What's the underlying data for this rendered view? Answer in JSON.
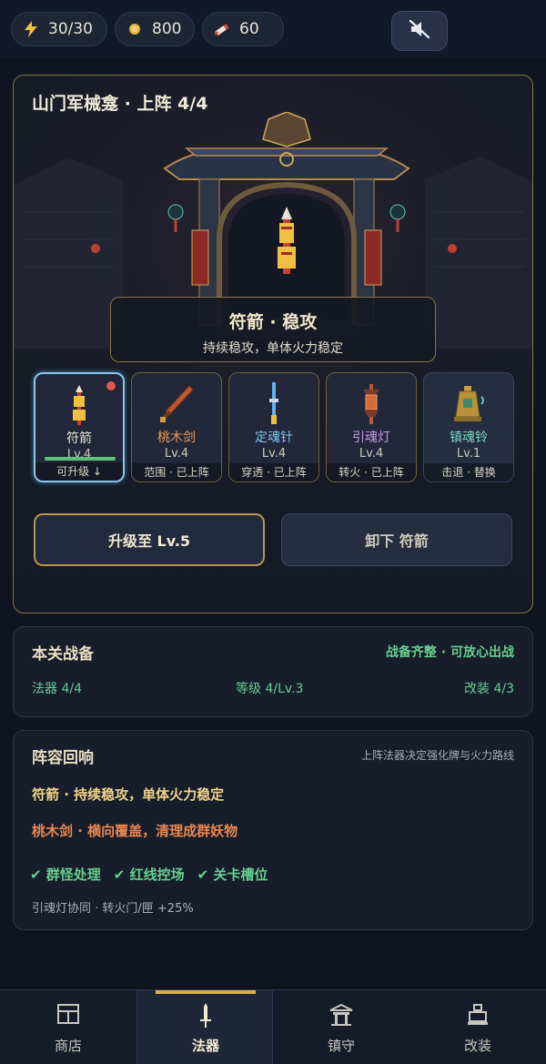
{
  "resources": {
    "energy": "30/30",
    "coins": "800",
    "scrolls": "60"
  },
  "main": {
    "title": "山门军械龛 · 上阵 4/4",
    "focus": {
      "name": "符箭 · 稳攻",
      "desc": "持续稳攻，单体火力稳定"
    },
    "slots": [
      {
        "name": "符箭",
        "level": "Lv.4",
        "status": "可升级 ↓",
        "name_color": "#f0e6c8"
      },
      {
        "name": "桃木剑",
        "level": "Lv.4",
        "status": "范围 · 已上阵",
        "name_color": "#ef9a57"
      },
      {
        "name": "定魂针",
        "level": "Lv.4",
        "status": "穿透 · 已上阵",
        "name_color": "#7ec6f0"
      },
      {
        "name": "引魂灯",
        "level": "Lv.4",
        "status": "转火 · 已上阵",
        "name_color": "#c79ae6"
      },
      {
        "name": "镇魂铃",
        "level": "Lv.1",
        "status": "击退 · 替换",
        "name_color": "#79d9c3"
      }
    ],
    "upgrade_label": "升级至 Lv.5",
    "unequip_label": "卸下 符箭"
  },
  "prep": {
    "title": "本关战备",
    "status": "战备齐整 · 可放心出战",
    "stats": [
      "法器 4/4",
      "等级 4/Lv.3",
      "改装 4/3"
    ]
  },
  "lineup": {
    "title": "阵容回响",
    "hint": "上阵法器决定强化牌与火力路线",
    "line1": "符箭 · 持续稳攻，单体火力稳定",
    "line2": "桃木剑 · 横向覆盖，清理成群妖物",
    "tags": [
      "✔ 群怪处理",
      "✔ 红线控场",
      "✔ 关卡槽位"
    ],
    "synergy": "引魂灯协同 · 转火门/匣 +25%"
  },
  "nav": {
    "items": [
      "商店",
      "法器",
      "镇守",
      "改装"
    ],
    "active": "法器"
  },
  "colors": {
    "gold_border": "#8a7442",
    "green_status": "#66cf8e",
    "selected_border": "#8fc4e8"
  }
}
